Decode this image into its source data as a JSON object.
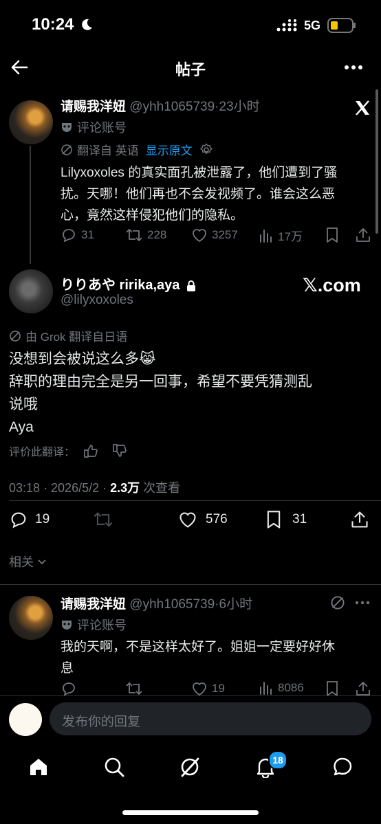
{
  "status_bar": {
    "time": "10:24",
    "network": "5G"
  },
  "header": {
    "title": "帖子"
  },
  "quoted_post": {
    "display_name": "请赐我洋妞",
    "handle_time": "@yhh1065739·23小时",
    "badge": "评论账号",
    "translate_note": "翻译自 英语",
    "show_original": "显示原文",
    "text_line1": "Lilyxoxoles 的真实面孔被泄露了，他们遭到了骚",
    "text_line2": "扰。天哪！他们再也不会发视频了。谁会这么恶",
    "text_line3": "心，竟然这样侵犯他们的隐私。",
    "replies": "31",
    "reposts": "228",
    "likes": "3257",
    "views": "17万"
  },
  "main_post": {
    "display_name": "りりあや ririka,aya",
    "handle": "@lilyxoxoles",
    "watermark": "𝕏.com",
    "translate_note": "由 Grok 翻译自日语",
    "line1": "没想到会被说这么多😹",
    "line2": "辞职的理由完全是另一回事，希望不要凭猜测乱",
    "line3": "说哦",
    "line4": "Aya",
    "rate_label": "评价此翻译：",
    "timestamp": "03:18 · 2026/5/2 · ",
    "views_count": "2.3万",
    "views_label": " 次查看",
    "replies": "19",
    "likes": "576",
    "bookmarks": "31"
  },
  "related": {
    "label": "相关"
  },
  "reply_post": {
    "display_name": "请赐我洋妞",
    "handle_time": "@yhh1065739·6小时",
    "badge": "评论账号",
    "text_line1": "我的天啊，不是这样太好了。姐姐一定要好好休",
    "text_line2": "息",
    "likes": "19",
    "views": "8086"
  },
  "reply_bar": {
    "placeholder": "发布你的回复"
  },
  "bottom_nav": {
    "notifications_badge": "18"
  }
}
